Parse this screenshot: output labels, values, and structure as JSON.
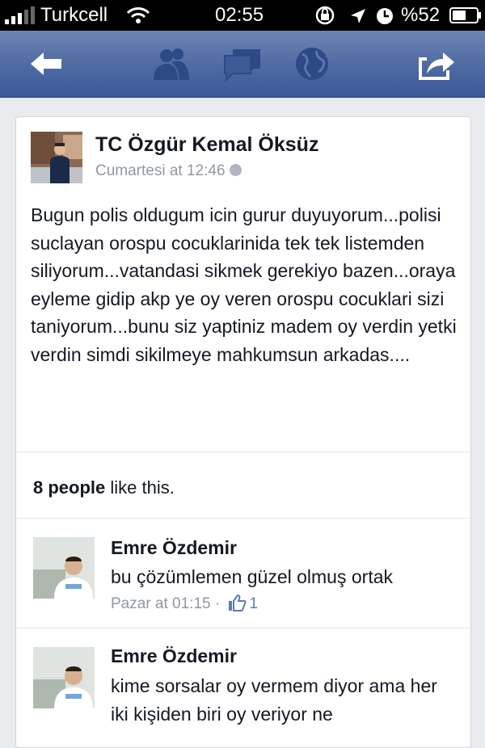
{
  "status_bar": {
    "carrier": "Turkcell",
    "time": "02:55",
    "battery": "%52"
  },
  "navbar": {
    "icons": [
      "back-arrow-icon",
      "friend-requests-icon",
      "messages-icon",
      "notifications-globe-icon",
      "share-icon"
    ]
  },
  "post": {
    "author": "TC Özgür Kemal Öksüz",
    "timestamp": "Cumartesi at 12:46",
    "body": "Bugun polis oldugum icin gurur duyuyorum...polisi suclayan orospu cocuklarinida tek tek listemden siliyorum...vatandasi sikmek gerekiyo bazen...oraya eyleme gidip akp ye oy veren orospu cocuklari sizi taniyorum...bunu siz yaptiniz madem oy verdin yetki  verdin simdi sikilmeye mahkumsun arkadas....",
    "likes_bold": "8 people",
    "likes_rest": " like this."
  },
  "comments": [
    {
      "name": "Emre Özdemir",
      "text": "bu çözümlemen güzel olmuş ortak",
      "time": "Pazar at 01:15",
      "separator": "·",
      "like_count": "1"
    },
    {
      "name": "Emre Özdemir",
      "text": "kime sorsalar oy vermem diyor ama her iki kişiden biri oy veriyor ne"
    }
  ],
  "colors": {
    "nav_bar": "#4e6aa3",
    "brand_blue": "#3b5998",
    "meta_grey": "#9197a3"
  }
}
